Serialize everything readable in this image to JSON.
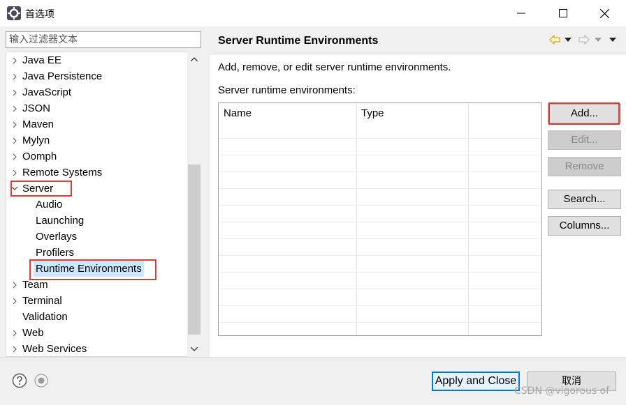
{
  "window": {
    "title": "首选项"
  },
  "filter": {
    "placeholder": "输入过滤器文本"
  },
  "tree": {
    "items": [
      {
        "label": "Java EE",
        "expanded": false,
        "has_children": true,
        "level": 0
      },
      {
        "label": "Java Persistence",
        "expanded": false,
        "has_children": true,
        "level": 0
      },
      {
        "label": "JavaScript",
        "expanded": false,
        "has_children": true,
        "level": 0
      },
      {
        "label": "JSON",
        "expanded": false,
        "has_children": true,
        "level": 0
      },
      {
        "label": "Maven",
        "expanded": false,
        "has_children": true,
        "level": 0
      },
      {
        "label": "Mylyn",
        "expanded": false,
        "has_children": true,
        "level": 0
      },
      {
        "label": "Oomph",
        "expanded": false,
        "has_children": true,
        "level": 0
      },
      {
        "label": "Remote Systems",
        "expanded": false,
        "has_children": true,
        "level": 0
      },
      {
        "label": "Server",
        "expanded": true,
        "has_children": true,
        "level": 0
      },
      {
        "label": "Audio",
        "expanded": false,
        "has_children": false,
        "level": 1
      },
      {
        "label": "Launching",
        "expanded": false,
        "has_children": false,
        "level": 1
      },
      {
        "label": "Overlays",
        "expanded": false,
        "has_children": false,
        "level": 1
      },
      {
        "label": "Profilers",
        "expanded": false,
        "has_children": false,
        "level": 1
      },
      {
        "label": "Runtime Environments",
        "expanded": false,
        "has_children": false,
        "level": 1,
        "selected": true
      },
      {
        "label": "Team",
        "expanded": false,
        "has_children": true,
        "level": 0
      },
      {
        "label": "Terminal",
        "expanded": false,
        "has_children": true,
        "level": 0
      },
      {
        "label": "Validation",
        "expanded": false,
        "has_children": false,
        "level": 0
      },
      {
        "label": "Web",
        "expanded": false,
        "has_children": true,
        "level": 0
      },
      {
        "label": "Web Services",
        "expanded": false,
        "has_children": true,
        "level": 0
      }
    ]
  },
  "page": {
    "title": "Server Runtime Environments",
    "description": "Add, remove, or edit server runtime environments.",
    "list_label": "Server runtime environments:",
    "table": {
      "columns": [
        "Name",
        "Type"
      ],
      "rows": []
    },
    "buttons": {
      "add": "Add...",
      "edit": "Edit...",
      "remove": "Remove",
      "search": "Search...",
      "columns": "Columns..."
    }
  },
  "footer": {
    "apply_close": "Apply and Close",
    "cancel": "取消",
    "watermark": "CSDN @vigorous of"
  },
  "colors": {
    "accent": "#0078d7",
    "selection": "#cce8ff",
    "highlight_box": "#e53935"
  }
}
